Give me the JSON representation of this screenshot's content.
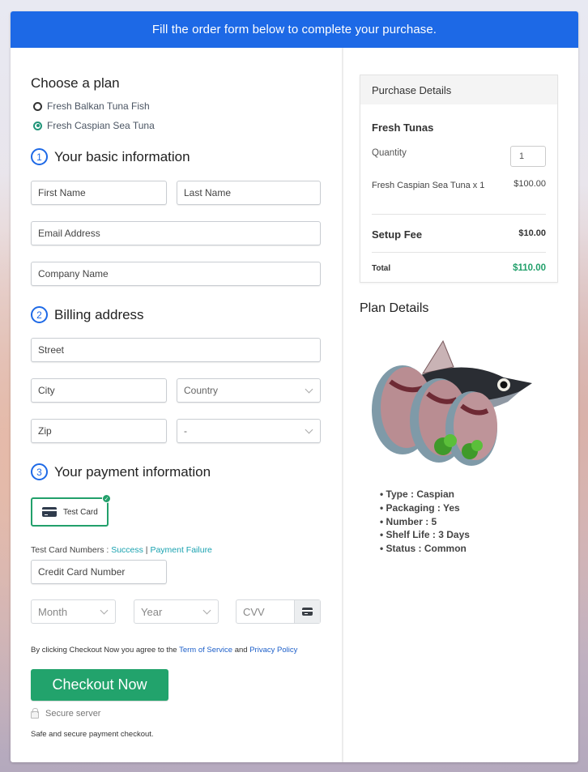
{
  "banner": {
    "text": "Fill the order form below to complete your purchase."
  },
  "plan": {
    "title": "Choose a plan",
    "options": [
      {
        "label": "Fresh Balkan Tuna Fish",
        "selected": false
      },
      {
        "label": "Fresh Caspian Sea Tuna",
        "selected": true
      }
    ]
  },
  "basic_info": {
    "step": "1",
    "title": "Your basic information",
    "first_name_placeholder": "First Name",
    "last_name_placeholder": "Last Name",
    "email_placeholder": "Email Address",
    "company_placeholder": "Company Name"
  },
  "billing": {
    "step": "2",
    "title": "Billing address",
    "street_placeholder": "Street",
    "city_placeholder": "City",
    "country_selected": "Country",
    "zip_placeholder": "Zip",
    "state_selected": "-"
  },
  "payment": {
    "step": "3",
    "title": "Your payment information",
    "method_label": "Test Card",
    "test_numbers_label": "Test Card Numbers : ",
    "success_link": "Success",
    "separator": " | ",
    "failure_link": "Payment Failure",
    "card_number_placeholder": "Credit Card Number",
    "month_selected": "Month",
    "year_selected": "Year",
    "cvv_placeholder": "CVV",
    "agree_prefix": "By clicking Checkout Now you agree to the ",
    "terms_link": "Term of Service",
    "agree_and": " and ",
    "privacy_link": "Privacy Policy",
    "checkout_label": "Checkout Now",
    "secure_label": "Secure server",
    "safe_text": "Safe and secure payment checkout."
  },
  "purchase": {
    "title": "Purchase Details",
    "product": "Fresh Tunas",
    "quantity_label": "Quantity",
    "quantity_value": "1",
    "item_label": "Fresh Caspian Sea Tuna x 1",
    "item_price": "$100.00",
    "setup_label": "Setup Fee",
    "setup_price": "$10.00",
    "total_label": "Total",
    "total_price": "$110.00"
  },
  "plan_details": {
    "title": "Plan Details",
    "image_alt": "tuna-steaks-image",
    "items": [
      "Type : Caspian",
      "Packaging : Yes",
      "Number : 5",
      "Shelf Life : 3 Days",
      "Status : Common"
    ]
  },
  "colors": {
    "brand_blue": "#1d69e6",
    "success_green": "#22a36c",
    "link_teal": "#1aa2b0"
  }
}
